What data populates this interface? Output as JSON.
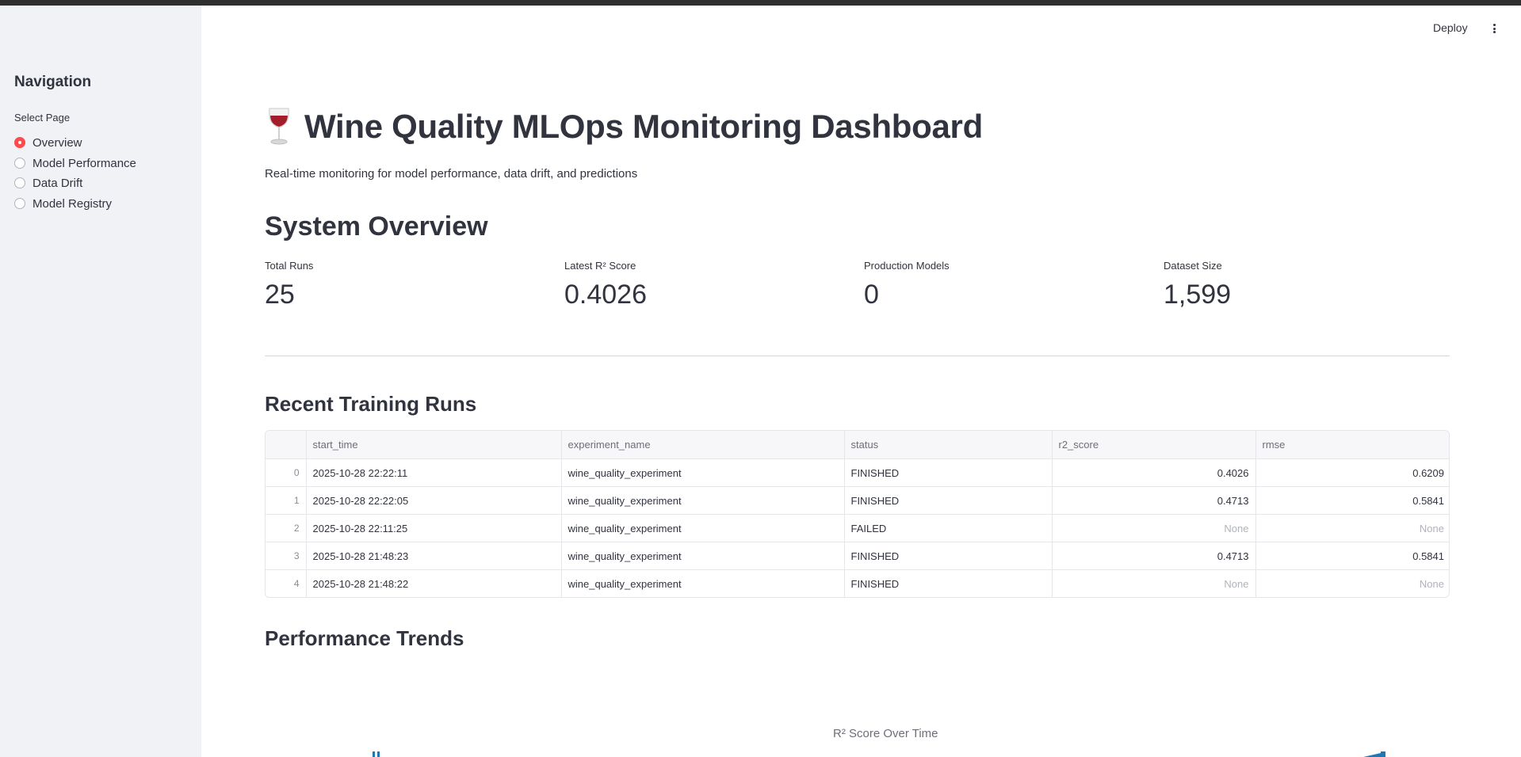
{
  "header": {
    "deploy_label": "Deploy"
  },
  "sidebar": {
    "title": "Navigation",
    "select_label": "Select Page",
    "items": [
      {
        "label": "Overview",
        "selected": true
      },
      {
        "label": "Model Performance",
        "selected": false
      },
      {
        "label": "Data Drift",
        "selected": false
      },
      {
        "label": "Model Registry",
        "selected": false
      }
    ]
  },
  "main": {
    "title": "Wine Quality MLOps Monitoring Dashboard",
    "subtitle": "Real-time monitoring for model performance, data drift, and predictions",
    "system_overview": {
      "heading": "System Overview",
      "metrics": [
        {
          "label": "Total Runs",
          "value": "25"
        },
        {
          "label": "Latest R² Score",
          "value": "0.4026"
        },
        {
          "label": "Production Models",
          "value": "0"
        },
        {
          "label": "Dataset Size",
          "value": "1,599"
        }
      ]
    },
    "recent_runs": {
      "heading": "Recent Training Runs",
      "columns": [
        "",
        "start_time",
        "experiment_name",
        "status",
        "r2_score",
        "rmse"
      ],
      "rows": [
        {
          "idx": "0",
          "start_time": "2025-10-28 22:22:11",
          "experiment_name": "wine_quality_experiment",
          "status": "FINISHED",
          "r2_score": "0.4026",
          "rmse": "0.6209"
        },
        {
          "idx": "1",
          "start_time": "2025-10-28 22:22:05",
          "experiment_name": "wine_quality_experiment",
          "status": "FINISHED",
          "r2_score": "0.4713",
          "rmse": "0.5841"
        },
        {
          "idx": "2",
          "start_time": "2025-10-28 22:11:25",
          "experiment_name": "wine_quality_experiment",
          "status": "FAILED",
          "r2_score": "None",
          "rmse": "None"
        },
        {
          "idx": "3",
          "start_time": "2025-10-28 21:48:23",
          "experiment_name": "wine_quality_experiment",
          "status": "FINISHED",
          "r2_score": "0.4713",
          "rmse": "0.5841"
        },
        {
          "idx": "4",
          "start_time": "2025-10-28 21:48:22",
          "experiment_name": "wine_quality_experiment",
          "status": "FINISHED",
          "r2_score": "None",
          "rmse": "None"
        }
      ]
    },
    "performance_trends": {
      "heading": "Performance Trends",
      "chart_title": "R² Score Over Time"
    }
  },
  "colors": {
    "accent": "#ff4b4b",
    "sidebar_bg": "#f0f2f6",
    "topbar": "#2f2f2f",
    "chart_series": "#1f77b4"
  },
  "icons": {
    "title_icon": "wine-glass-icon",
    "menu_icon": "kebab-menu-icon"
  }
}
